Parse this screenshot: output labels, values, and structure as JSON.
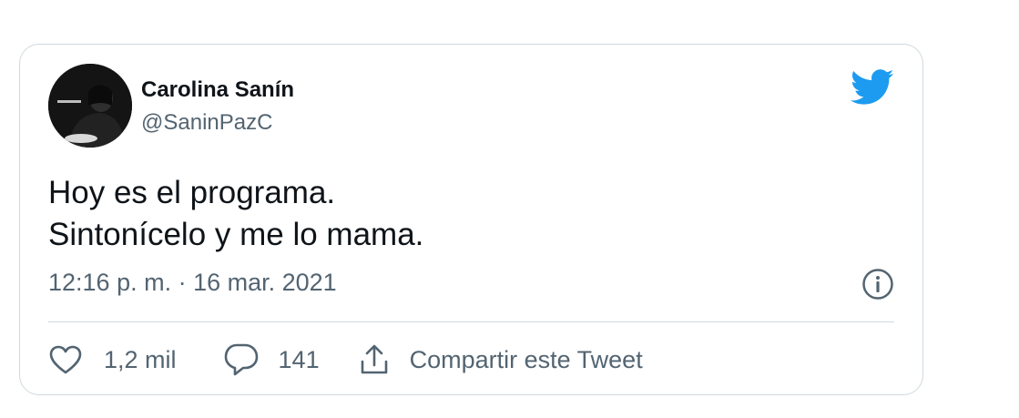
{
  "tweet": {
    "author_name": "Carolina Sanín",
    "author_handle": "@SaninPazC",
    "lines": [
      "Hoy es el programa.",
      "Sintonícelo y me lo mama."
    ],
    "timestamp": "12:16 p. m. · 16 mar. 2021",
    "likes": "1,2 mil",
    "replies": "141",
    "share_label": "Compartir este Tweet"
  },
  "icons": {
    "brand": "twitter-bird-icon",
    "info": "info-icon",
    "like": "heart-icon",
    "reply": "reply-bubble-icon",
    "share": "share-upload-icon"
  },
  "colors": {
    "brand": "#1d9bf0",
    "text": "#0f1419",
    "muted": "#536471",
    "border": "#cfd9de"
  }
}
